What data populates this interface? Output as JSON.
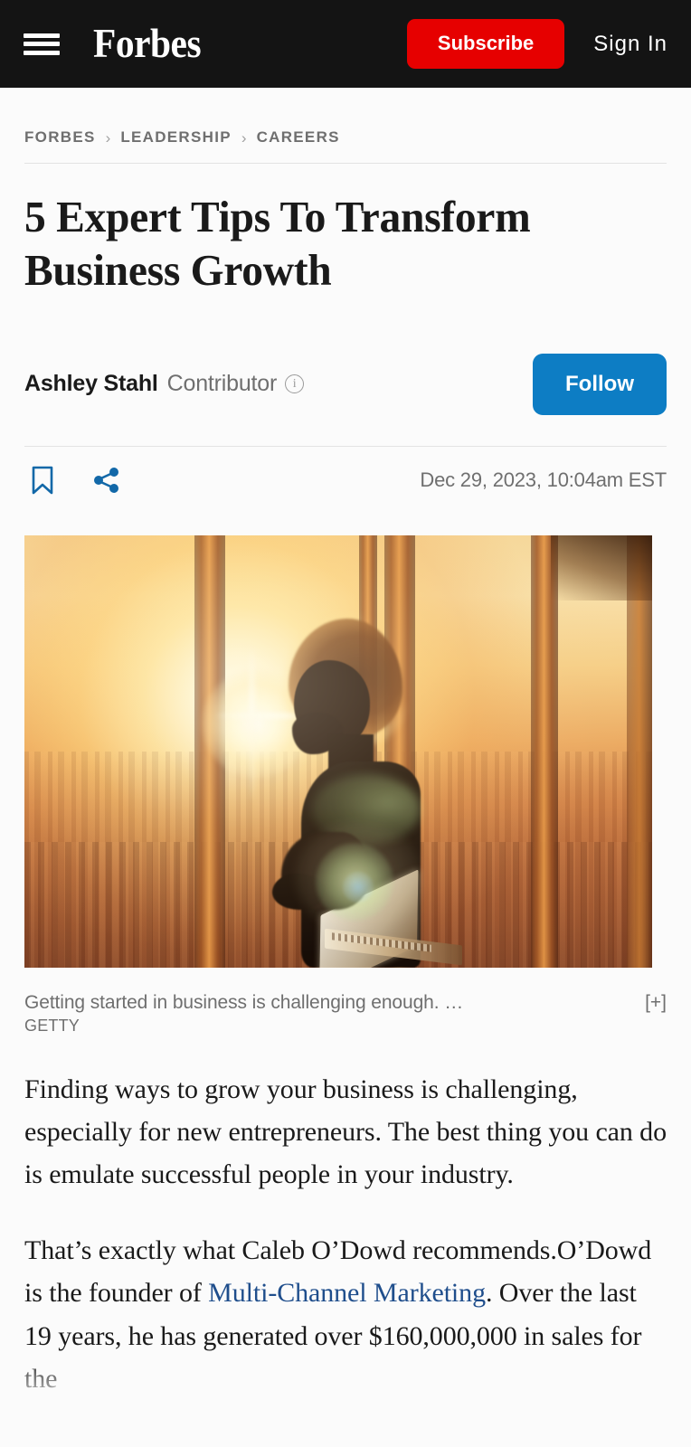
{
  "nav": {
    "menu_icon": "hamburger-menu-icon",
    "brand": "Forbes",
    "subscribe_label": "Subscribe",
    "signin_label": "Sign In",
    "background_color": "#141414",
    "subscribe_color": "#e60000"
  },
  "breadcrumb": {
    "items": [
      "FORBES",
      "LEADERSHIP",
      "CAREERS"
    ],
    "separator": "›"
  },
  "article": {
    "headline": "5 Expert Tips To Transform Business Growth",
    "author": {
      "name": "Ashley Stahl",
      "role": "Contributor",
      "info_icon": "info-circle-icon"
    },
    "follow_label": "Follow",
    "follow_color": "#0d7dc4",
    "timestamp": "Dec 29, 2023, 10:04am EST",
    "actions": {
      "bookmark_icon": "bookmark-icon",
      "share_icon": "share-icon",
      "icon_color": "#1268a8"
    }
  },
  "hero": {
    "alt": "Silhouette of a woman holding a laptop beside tall office windows at sunset",
    "caption": "Getting started in business is challenging enough. …",
    "expand_label": "[+]",
    "credit": "GETTY"
  },
  "body": {
    "paragraph_1": "Finding ways to grow your business is challenging, especially for new entrepreneurs. The best thing you can do is emulate successful people in your industry.",
    "p2_before_link": "That’s exactly what Caleb O’Dowd recommends.O’Dowd is the founder of ",
    "p2_link_text": "Multi-Channel Marketing",
    "p2_after_link": ". Over the last 19 years, he has generated over $160,000,000 in sales for the",
    "link_color": "#1f4e8c"
  }
}
